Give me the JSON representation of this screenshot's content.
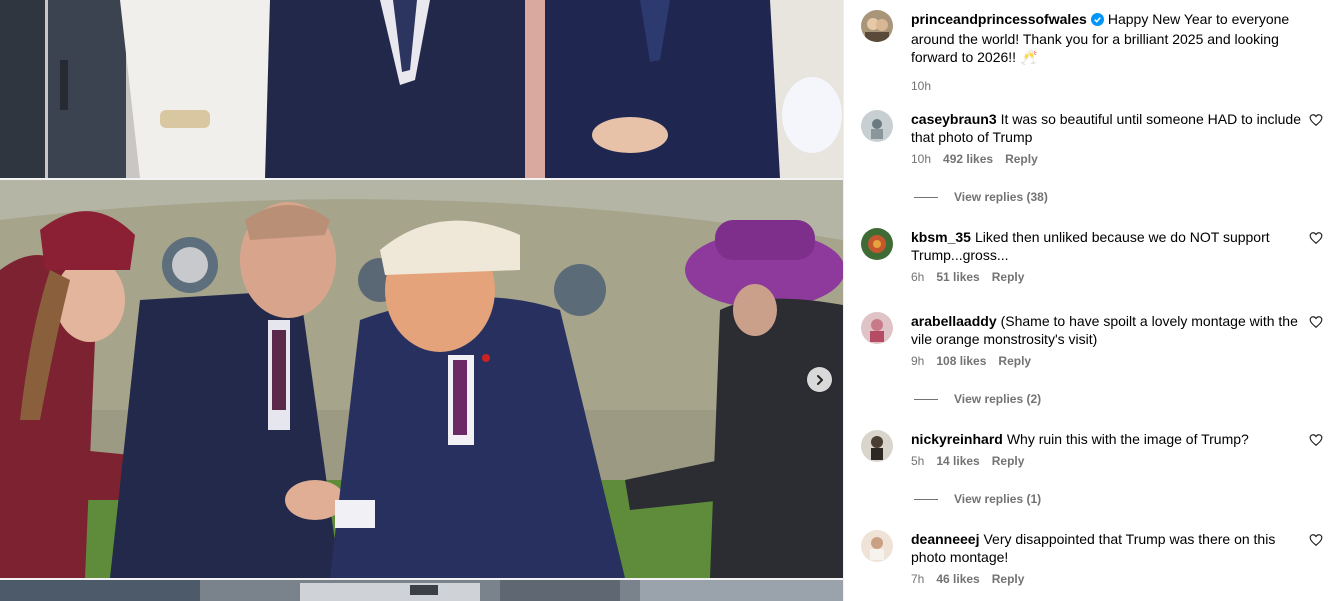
{
  "post": {
    "author": "princeandprincessofwales",
    "caption": "Happy New Year to everyone around the world! Thank you for a brilliant 2025 and looking forward to 2026!!",
    "caption_emoji": "🥂",
    "time": "10h"
  },
  "carousel": {
    "next_icon": "chevron-right-icon"
  },
  "comments": [
    {
      "user": "caseybraun3",
      "text": "It was so beautiful until someone HAD to include that photo of Trump",
      "time": "10h",
      "likes": "492 likes",
      "reply": "Reply",
      "view_replies": "View replies (38)"
    },
    {
      "user": "kbsm_35",
      "text": "Liked then unliked because we do NOT support Trump...gross...",
      "time": "6h",
      "likes": "51 likes",
      "reply": "Reply"
    },
    {
      "user": "arabellaaddy",
      "text": "(Shame to have spoilt a lovely montage with the vile orange monstrosity's visit)",
      "time": "9h",
      "likes": "108 likes",
      "reply": "Reply",
      "view_replies": "View replies (2)"
    },
    {
      "user": "nickyreinhard",
      "text": "Why ruin this with the image of Trump?",
      "time": "5h",
      "likes": "14 likes",
      "reply": "Reply",
      "view_replies": "View replies (1)"
    },
    {
      "user": "deanneeej",
      "text": "Very disappointed that Trump was there on this photo montage!",
      "time": "7h",
      "likes": "46 likes",
      "reply": "Reply"
    }
  ],
  "colors": {
    "verified": "#0095f6",
    "meta": "#737373",
    "wine": "#7a1f2f",
    "purple_hat": "#8e3a9c",
    "navy_suit": "#23294a"
  }
}
